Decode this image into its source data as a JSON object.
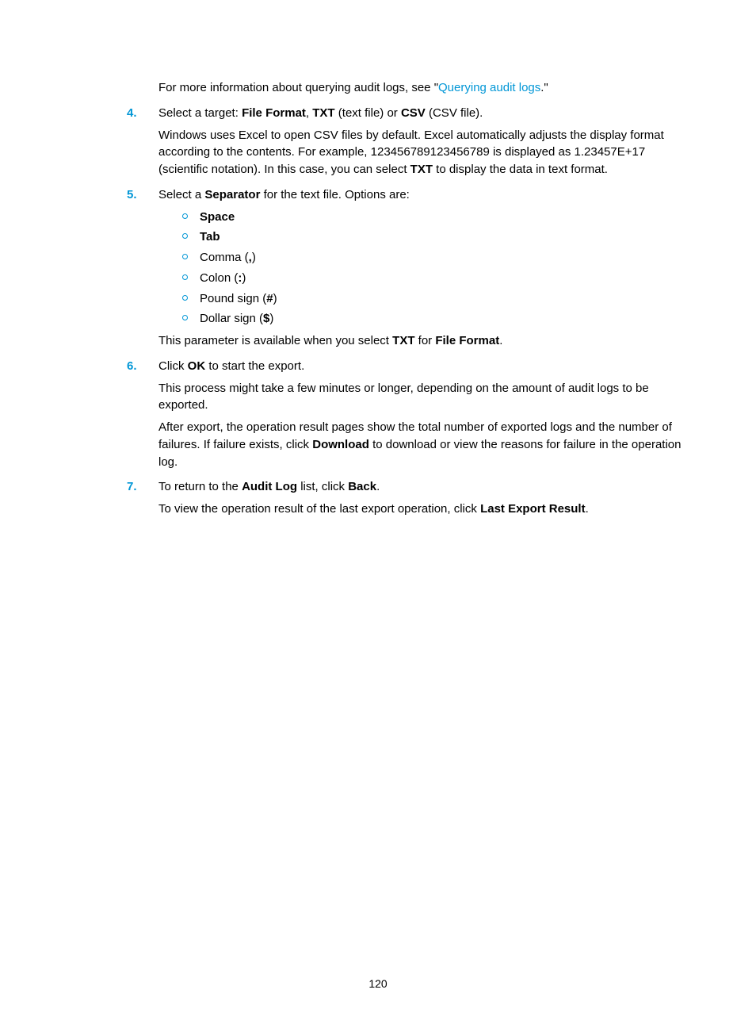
{
  "intro": {
    "t1": "For more information about querying audit logs, see \"",
    "link": "Querying audit logs",
    "t2": ".\""
  },
  "step4": {
    "num": "4.",
    "p1a": "Select a target: ",
    "b1": "File Format",
    "p1b": ", ",
    "b2": "TXT",
    "p1c": " (text file) or ",
    "b3": "CSV",
    "p1d": " (CSV file).",
    "p2a": "Windows uses Excel to open CSV files by default. Excel automatically adjusts the display format according to the contents. For example, 123456789123456789 is displayed as 1.23457E+17 (scientific notation). In this case, you can select ",
    "p2b": "TXT",
    "p2c": " to display the data in text format."
  },
  "step5": {
    "num": "5.",
    "p1a": "Select a ",
    "p1b": "Separator",
    "p1c": " for the text file. Options are:",
    "opts": {
      "o1": "Space",
      "o2": "Tab",
      "o3a": "Comma (",
      "o3b": ",",
      "o3c": ")",
      "o4a": "Colon (",
      "o4b": ":",
      "o4c": ")",
      "o5a": "Pound sign (",
      "o5b": "#",
      "o5c": ")",
      "o6a": "Dollar sign (",
      "o6b": "$",
      "o6c": ")"
    },
    "p2a": "This parameter is available when you select ",
    "p2b": "TXT",
    "p2c": " for ",
    "p2d": "File Format",
    "p2e": "."
  },
  "step6": {
    "num": "6.",
    "p1a": "Click ",
    "p1b": "OK",
    "p1c": " to start the export.",
    "p2": "This process might take a few minutes or longer, depending on the amount of audit logs to be exported.",
    "p3a": "After export, the operation result pages show the total number of exported logs and the number of failures. If failure exists, click ",
    "p3b": "Download",
    "p3c": " to download or view the reasons for failure in the operation log."
  },
  "step7": {
    "num": "7.",
    "p1a": "To return to the ",
    "p1b": "Audit Log",
    "p1c": " list, click ",
    "p1d": "Back",
    "p1e": ".",
    "p2a": "To view the operation result of the last export operation, click ",
    "p2b": "Last Export Result",
    "p2c": "."
  },
  "pageNumber": "120"
}
